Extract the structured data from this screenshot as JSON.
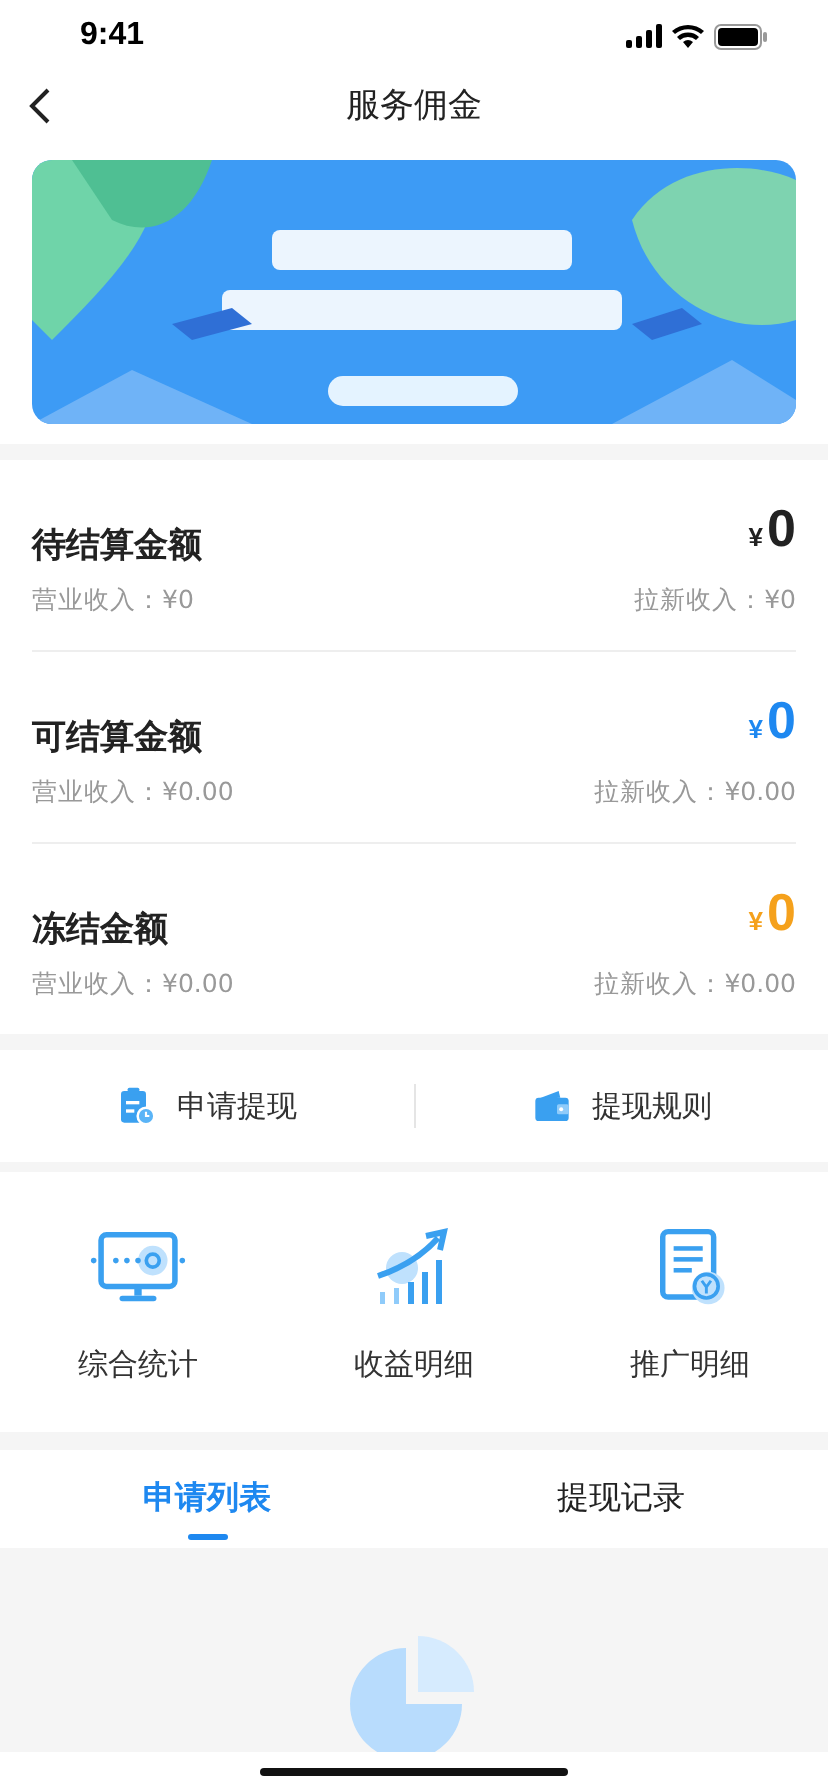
{
  "status_bar": {
    "time": "9:41"
  },
  "nav": {
    "title": "服务佣金"
  },
  "balances": [
    {
      "title": "待结算金额",
      "currency": "¥",
      "amount": "0",
      "color": "#222222",
      "left": "营业收入：¥0",
      "right": "拉新收入：¥0"
    },
    {
      "title": "可结算金额",
      "currency": "¥",
      "amount": "0",
      "color": "#1e88f0",
      "left": "营业收入：¥0.00",
      "right": "拉新收入：¥0.00"
    },
    {
      "title": "冻结金额",
      "currency": "¥",
      "amount": "0",
      "color": "#f5a11c",
      "left": "营业收入：¥0.00",
      "right": "拉新收入：¥0.00"
    }
  ],
  "actions": [
    {
      "kind": "apply",
      "label": "申请提现"
    },
    {
      "kind": "rules",
      "label": "提现规则"
    }
  ],
  "features": [
    {
      "kind": "stats",
      "label": "综合统计"
    },
    {
      "kind": "income",
      "label": "收益明细"
    },
    {
      "kind": "promo",
      "label": "推广明细"
    }
  ],
  "tabs": [
    {
      "label": "申请列表",
      "selected": true
    },
    {
      "label": "提现记录",
      "selected": false
    }
  ]
}
